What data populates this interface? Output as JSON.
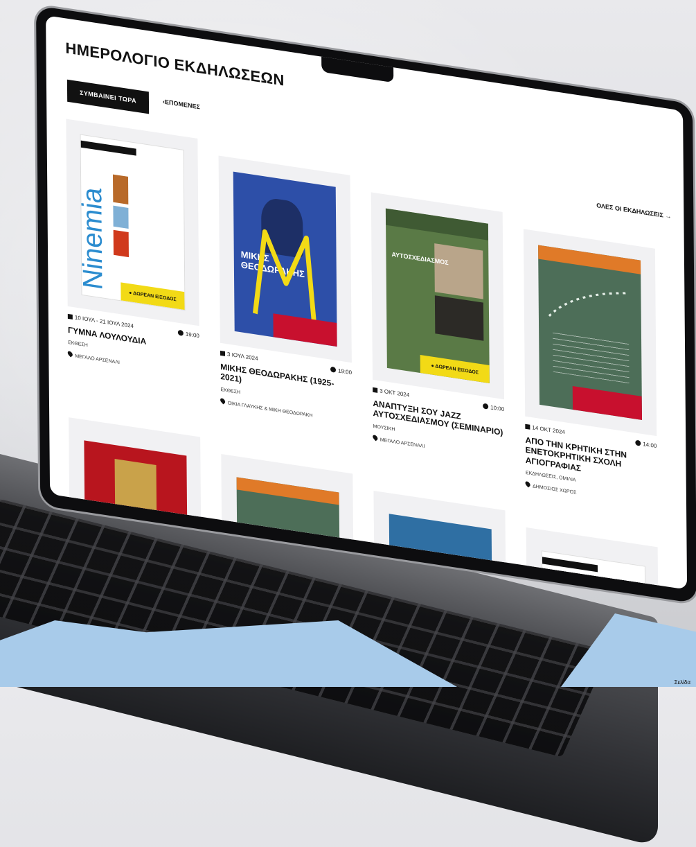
{
  "page": {
    "title": "ΗΜΕΡΟΛΟΓΙΟ ΕΚΔΗΛΩΣΕΩΝ",
    "tab_active": "ΣΥΜΒΑΙΝΕΙ ΤΩΡΑ",
    "tab_inactive": "ΕΠΟΜΕΝΕΣ",
    "all_events_link": "ΟΛΕΣ ΟΙ ΕΚΔΗΛΩΣΕΙΣ →"
  },
  "events": [
    {
      "date": "10 ΙΟΥΛ - 21 ΙΟΥΛ 2024",
      "time": "19:00",
      "title": "ΓΥΜΝΑ ΛΟΥΛΟΥΔΙΑ",
      "category": "ΕΚΘΕΣΗ",
      "venue": "ΜΕΓΑΛΟ ΑΡΣΕΝΑΛΙ",
      "poster_text": "Ninemia",
      "badge": "● ΔΩΡΕΑΝ ΕΙΣΟΔΟΣ",
      "colors": {
        "accent": "#f2da16",
        "poster": "#2b8ccf"
      }
    },
    {
      "date": "3 ΙΟΥΛ 2024",
      "time": "19:00",
      "title": "ΜΙΚΗΣ ΘΕΟΔΩΡΑΚΗΣ (1925-2021)",
      "category": "ΕΚΘΕΣΗ",
      "venue": "ΟΙΚΙΑ ΓΛΑΥΚΗΣ & ΜΙΚΗ ΘΕΟΔΩΡΑΚΗ",
      "poster_text": "ΜΙΚΗΣ ΘΕΟΔΩΡΑΚΗΣ",
      "colors": {
        "accent": "#c8102e",
        "poster": "#2d4fa8"
      }
    },
    {
      "date": "3 ΟΚΤ 2024",
      "time": "10:00",
      "title": "ΑΝΑΠΤΥΞΗ ΣΟΥ JAZZ ΑΥΤΟΣΧΕΔΙΑΣΜΟΥ (ΣΕΜΙΝΑΡΙΟ)",
      "category": "ΜΟΥΣΙΚΗ",
      "venue": "ΜΕΓΑΛΟ ΑΡΣΕΝΑΛΙ",
      "poster_text": "ΑΥΤΟΣΧΕΔΙΑΣΜΟΣ",
      "badge": "● ΔΩΡΕΑΝ ΕΙΣΟΔΟΣ",
      "colors": {
        "accent": "#f2da16",
        "poster": "#5a7a46"
      }
    },
    {
      "date": "14 ΟΚΤ 2024",
      "time": "14:00",
      "title": "ΑΠΟ ΤΗΝ ΚΡΗΤΙΚΗ ΣΤΗΝ ΕΝΕΤΟΚΡΗΤΙΚΗ ΣΧΟΛΗ ΑΓΙΟΓΡΑΦΙΑΣ",
      "category": "ΕΚΔΗΛΩΣΕΙΣ, ΟΜΙΛΙΑ",
      "venue": "ΔΗΜΟΣΙΟΣ ΧΩΡΟΣ",
      "colors": {
        "accent": "#c8102e",
        "poster": "#4d6e58",
        "top": "#e07a28"
      }
    }
  ],
  "corner_text": "Σελίδα"
}
